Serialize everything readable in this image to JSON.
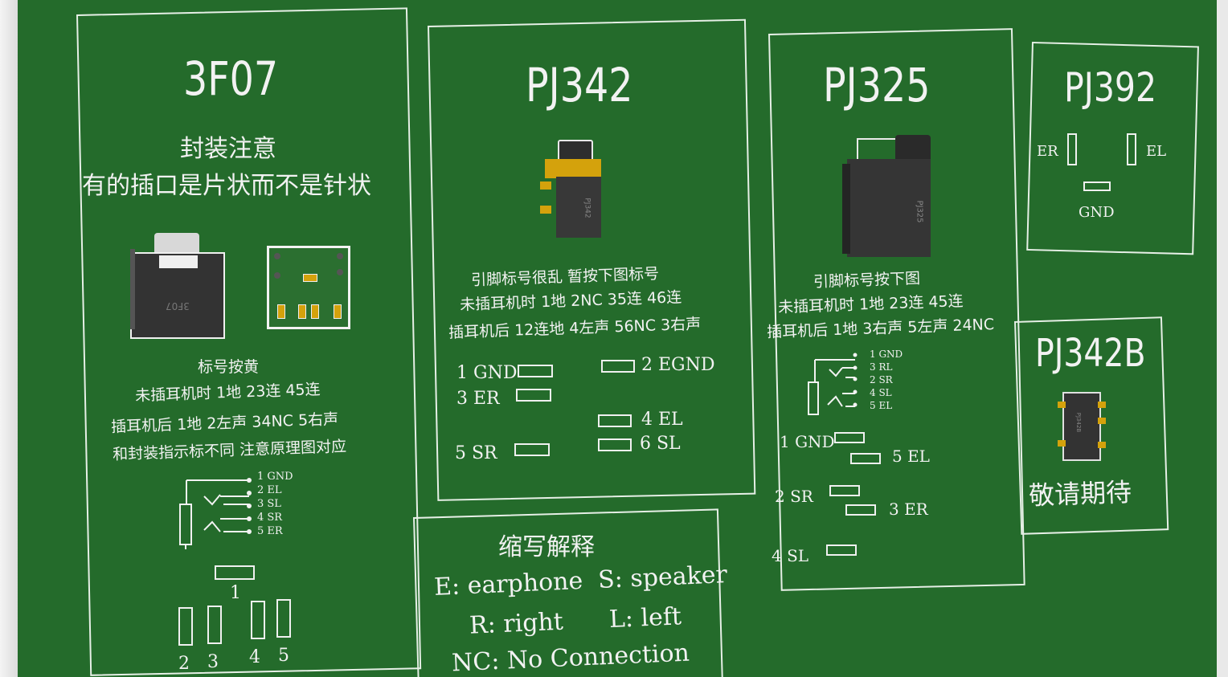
{
  "colors": {
    "board": "#246b2b",
    "silk": "#f2f2f2",
    "gold": "#d4a20c",
    "body": "#2f2f2f"
  },
  "p3f07": {
    "title": "3F07",
    "note1": "封装注意",
    "note2": "有的插口是片状而不是针状",
    "model_mark": "3F07",
    "line1": "标号按黄",
    "line2": "未插耳机时  1地  23连  45连",
    "line3": "插耳机后  1地  2左声  34NC  5右声",
    "line4": "和封装指示标不同  注意原理图对应",
    "sch": [
      "1 GND",
      "2 EL",
      "3 SL",
      "4 SR",
      "5 ER"
    ],
    "pad_nums": [
      "1",
      "2",
      "3",
      "4",
      "5"
    ]
  },
  "pj342": {
    "title": "PJ342",
    "model_mark": "PJ342",
    "line1": "引脚标号很乱  暂按下图标号",
    "line2": "未插耳机时  1地  2NC  35连  46连",
    "line3": "插耳机后  12连地  4左声  56NC  3右声",
    "pins": [
      "1 GND",
      "3 ER",
      "5 SR",
      "2 EGND",
      "4 EL",
      "6 SL"
    ]
  },
  "pj325": {
    "title": "PJ325",
    "model_mark": "PJ325",
    "line1": "引脚标号按下图",
    "line2": "未插耳机时  1地  23连  45连",
    "line3": "插耳机后  1地  3右声  5左声  24NC",
    "sch": [
      "1 GND",
      "3 RL",
      "2 SR",
      "4 SL",
      "5 EL"
    ],
    "pins": [
      "1 GND",
      "5 EL",
      "2 SR",
      "3 ER",
      "4 SL"
    ]
  },
  "pj392": {
    "title": "PJ392",
    "er": "ER",
    "el": "EL",
    "gnd": "GND"
  },
  "pj342b": {
    "title": "PJ342B",
    "model_mark": "PJ342B",
    "wait": "敬请期待"
  },
  "abbr": {
    "title": "缩写解释",
    "line1": "E: earphone  S: speaker",
    "line2": "R: right      L: left",
    "line3": "NC: No Connection"
  }
}
